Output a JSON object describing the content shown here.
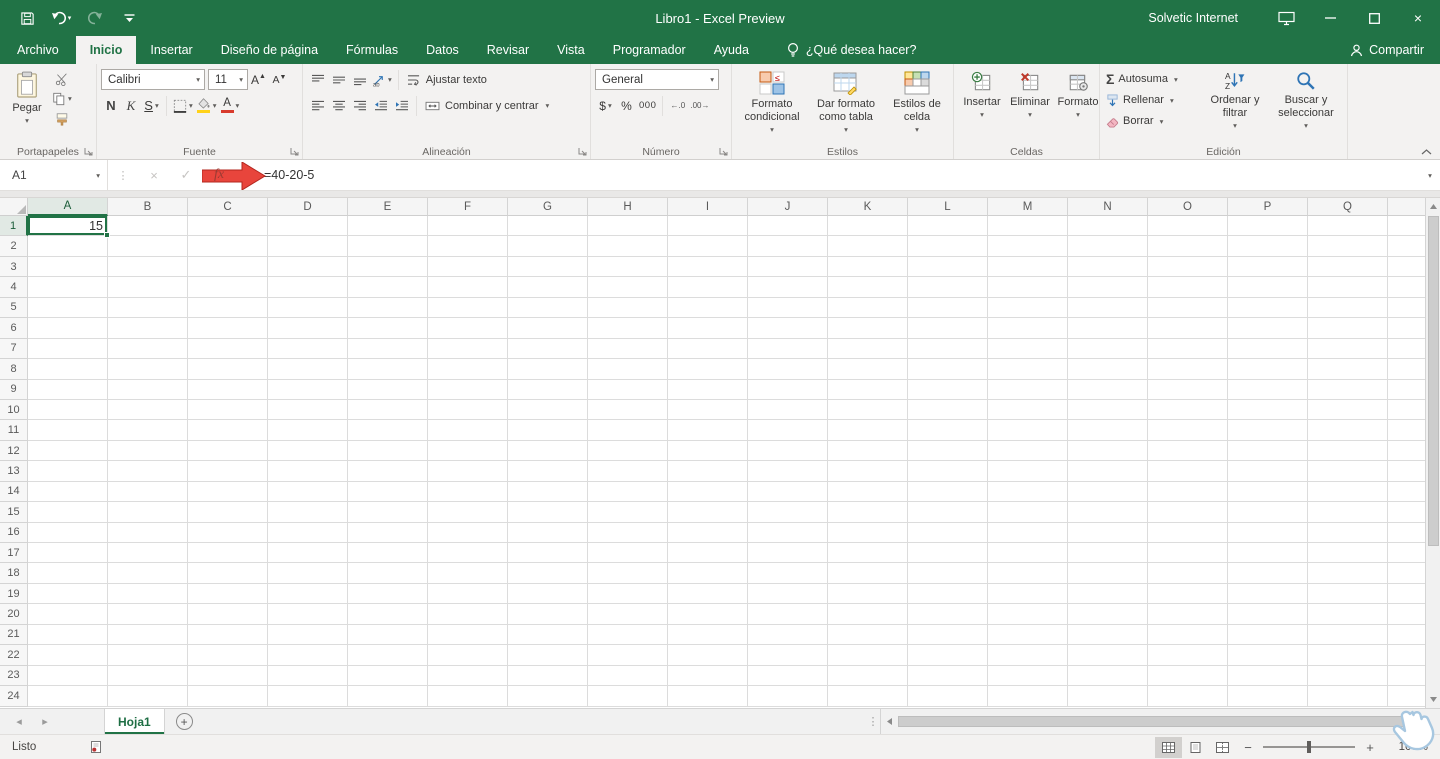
{
  "window": {
    "title": "Libro1 - Excel Preview",
    "user": "Solvetic Internet"
  },
  "tabs": {
    "file": "Archivo",
    "items": [
      "Inicio",
      "Insertar",
      "Diseño de página",
      "Fórmulas",
      "Datos",
      "Revisar",
      "Vista",
      "Programador",
      "Ayuda"
    ],
    "active": "Inicio",
    "tell_me": "¿Qué desea hacer?",
    "share": "Compartir"
  },
  "ribbon": {
    "clipboard": {
      "label": "Portapapeles",
      "paste": "Pegar"
    },
    "font": {
      "label": "Fuente",
      "family": "Calibri",
      "size": "11",
      "bold": "N",
      "italic": "K",
      "underline": "S",
      "letter": "A"
    },
    "alignment": {
      "label": "Alineación",
      "wrap_text": "Ajustar texto",
      "merge_center": "Combinar y centrar"
    },
    "number": {
      "label": "Número",
      "format": "General",
      "currency": "$",
      "percent": "%",
      "thousands": "000"
    },
    "styles": {
      "label": "Estilos",
      "conditional": "Formato condicional",
      "format_table": "Dar formato como tabla",
      "cell_styles": "Estilos de celda"
    },
    "cells": {
      "label": "Celdas",
      "insert": "Insertar",
      "delete": "Eliminar",
      "format": "Formato"
    },
    "editing": {
      "label": "Edición",
      "autosum": "Autosuma",
      "fill": "Rellenar",
      "clear": "Borrar",
      "sort_filter": "Ordenar y filtrar",
      "find_select": "Buscar y seleccionar"
    }
  },
  "formula_bar": {
    "name_box": "A1",
    "formula": "=40-20-5"
  },
  "grid": {
    "columns": [
      "A",
      "B",
      "C",
      "D",
      "E",
      "F",
      "G",
      "H",
      "I",
      "J",
      "K",
      "L",
      "M",
      "N",
      "O",
      "P",
      "Q"
    ],
    "row_count": 24,
    "cells": {
      "A1": "15"
    },
    "selection": {
      "col": "A",
      "row": 1
    }
  },
  "sheet_bar": {
    "sheets": [
      "Hoja1"
    ],
    "active_sheet": "Hoja1"
  },
  "status_bar": {
    "mode": "Listo",
    "zoom": "100%"
  },
  "colors": {
    "excel_green": "#217346",
    "arrow_red": "#e8453c"
  }
}
